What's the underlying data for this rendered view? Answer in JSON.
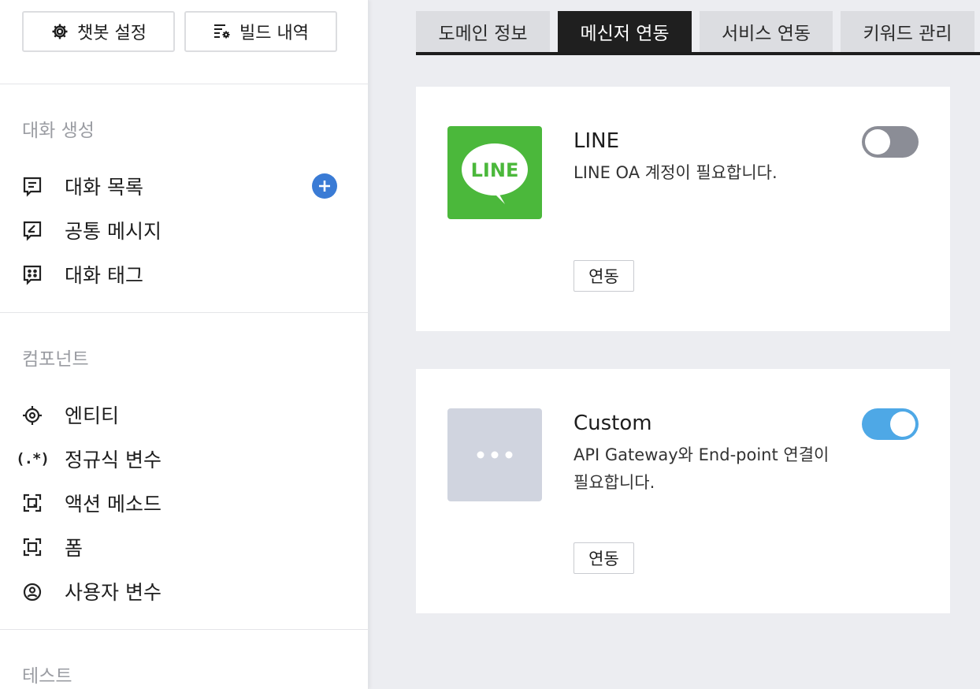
{
  "sidebar": {
    "top_buttons": {
      "settings_label": "챗봇 설정",
      "build_label": "빌드 내역"
    },
    "sections": {
      "conversation": {
        "title": "대화 생성",
        "items": [
          "대화 목록",
          "공통 메시지",
          "대화 태그"
        ]
      },
      "component": {
        "title": "컴포넌트",
        "items": [
          "엔티티",
          "정규식 변수",
          "액션 메소드",
          "폼",
          "사용자 변수"
        ]
      },
      "test": {
        "title": "테스트"
      }
    },
    "regex_icon_text": "(.*)"
  },
  "tabs": [
    {
      "label": "도메인 정보",
      "active": false
    },
    {
      "label": "메신저 연동",
      "active": true
    },
    {
      "label": "서비스 연동",
      "active": false
    },
    {
      "label": "키워드 관리",
      "active": false
    }
  ],
  "cards": [
    {
      "title": "LINE",
      "description": "LINE OA 계정이 필요합니다.",
      "logo_text": "LINE",
      "toggle_on": false,
      "button_label": "연동"
    },
    {
      "title": "Custom",
      "description": "API Gateway와 End-point 연결이 필요합니다.",
      "logo_icon": "more-dots-icon",
      "toggle_on": true,
      "button_label": "연동"
    }
  ],
  "colors": {
    "accent_blue": "#3a7bd5",
    "toggle_on": "#4ea8e6",
    "toggle_off": "#8b8d96",
    "line_green": "#4bb83b",
    "background": "#ecedf1"
  }
}
